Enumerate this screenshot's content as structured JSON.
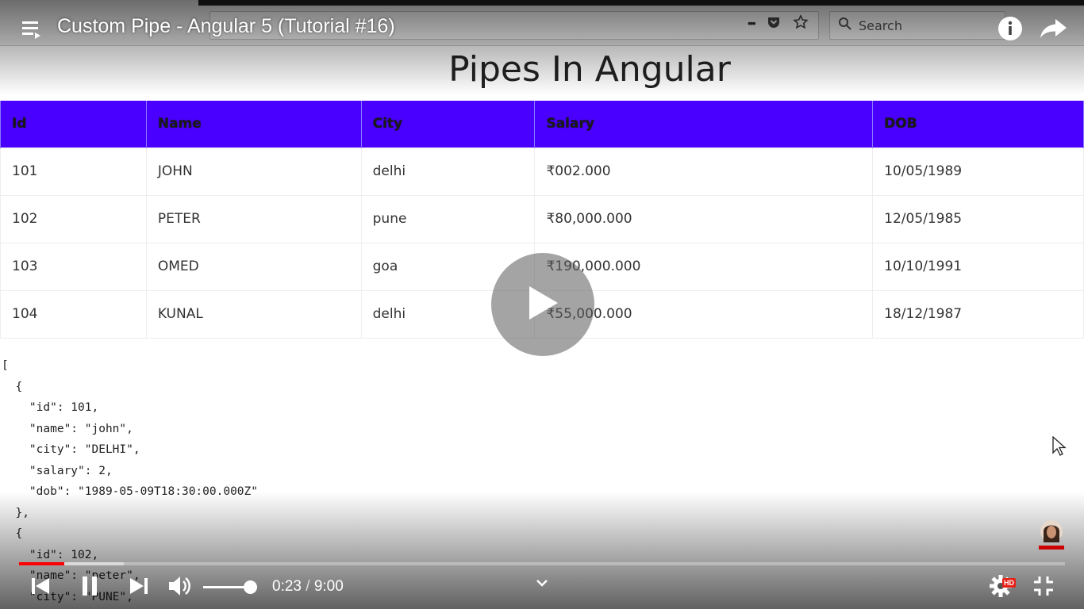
{
  "browser": {
    "search_placeholder": "Search",
    "toolbar_more_glyph": "•••"
  },
  "player": {
    "title": "Custom Pipe - Angular 5 (Tutorial #16)",
    "current_time": "0:23",
    "time_separator": " / ",
    "duration": "9:00",
    "progress_fraction": 0.043,
    "buffered_fraction": 0.1,
    "volume_fraction": 0.88,
    "hd_badge": "HD",
    "accent_color": "#ff0000"
  },
  "page": {
    "heading": "Pipes In Angular",
    "header_color": "#4a00ff",
    "table": {
      "columns": [
        "Id",
        "Name",
        "City",
        "Salary",
        "DOB"
      ],
      "rows": [
        [
          "101",
          "JOHN",
          "delhi",
          "₹002.000",
          "10/05/1989"
        ],
        [
          "102",
          "PETER",
          "pune",
          "₹80,000.000",
          "12/05/1985"
        ],
        [
          "103",
          "OMED",
          "goa",
          "₹190,000.000",
          "10/10/1991"
        ],
        [
          "104",
          "KUNAL",
          "delhi",
          "₹55,000.000",
          "18/12/1987"
        ]
      ]
    },
    "json_dump": "[\n  {\n    \"id\": 101,\n    \"name\": \"john\",\n    \"city\": \"DELHI\",\n    \"salary\": 2,\n    \"dob\": \"1989-05-09T18:30:00.000Z\"\n  },\n  {\n    \"id\": 102,\n    \"name\": \"peter\",\n    \"city\": \"PUNE\","
  },
  "icons": [
    "playlist-icon",
    "info-icon",
    "share-icon",
    "play-icon",
    "previous-icon",
    "pause-icon",
    "next-icon",
    "volume-icon",
    "chevron-down-icon",
    "gear-icon",
    "exit-fullscreen-icon",
    "search-icon",
    "pocket-icon",
    "star-icon",
    "cursor-icon",
    "subscribe-avatar-icon"
  ]
}
